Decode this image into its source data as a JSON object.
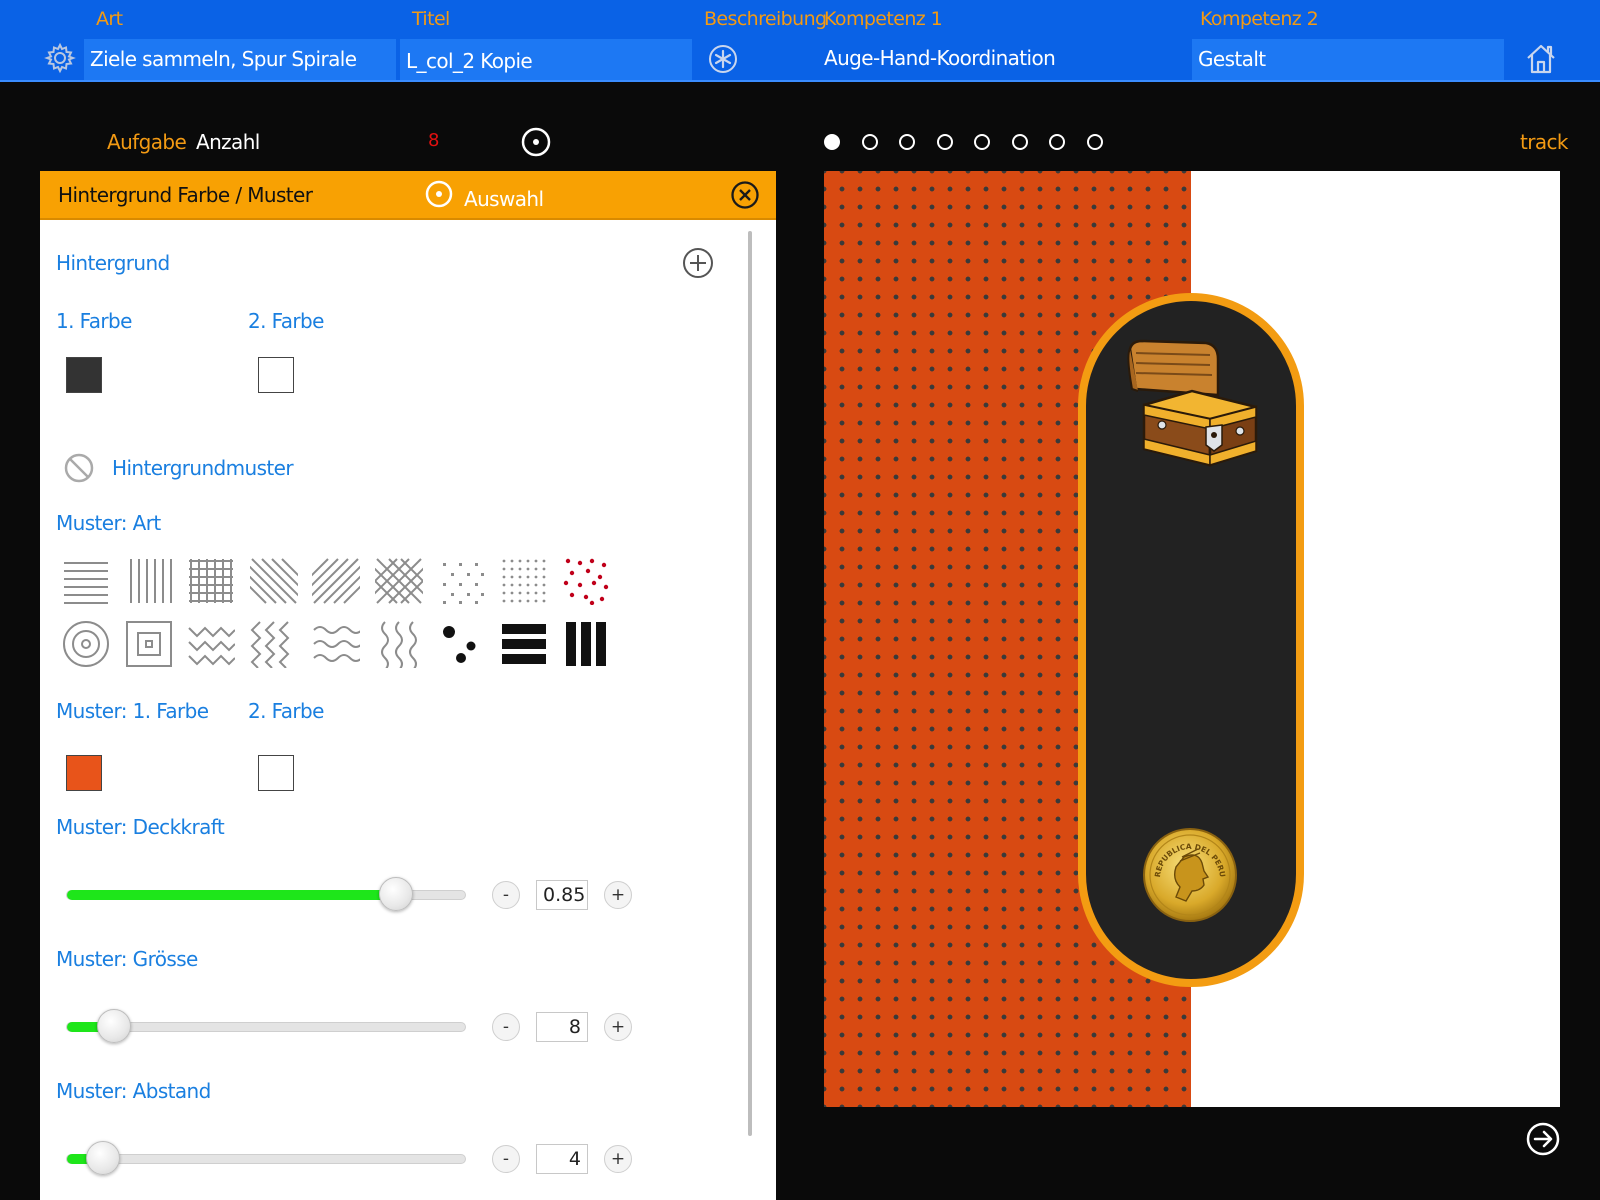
{
  "header": {
    "art_label": "Art",
    "art_value": "Ziele sammeln, Spur Spirale",
    "titel_label": "Titel",
    "titel_value": "L_col_2 Kopie",
    "beschreibung_label": "Beschreibung",
    "kompetenz1_label": "Kompetenz 1",
    "kompetenz1_value": "Auge-Hand-Koordination",
    "kompetenz2_label": "Kompetenz 2",
    "kompetenz2_value": "Gestalt",
    "icons": [
      "gear-icon",
      "asterisk-icon",
      "home-icon"
    ]
  },
  "toolbar": {
    "aufgabe": "Aufgabe",
    "anzahl": "Anzahl",
    "anzahl_value": "8",
    "pager_count": 8,
    "pager_active": 1,
    "track": "track"
  },
  "panel": {
    "title": "Hintergrund Farbe / Muster",
    "auswahl": "Auswahl",
    "hintergrund": "Hintergrund",
    "farbe1": "1. Farbe",
    "farbe2": "2. Farbe",
    "farbe1_color": "#333333",
    "farbe2_color": "#ffffff",
    "hintergrundmuster": "Hintergrundmuster",
    "muster_art": "Muster: Art",
    "patterns": [
      "horizontal-lines",
      "vertical-lines",
      "grid",
      "diagonal-lines-left",
      "diagonal-lines-right",
      "crosshatch",
      "sparse-dots",
      "dense-dots",
      "red-dots",
      "concentric-circles",
      "concentric-squares",
      "zigzag-horizontal",
      "zigzag-vertical",
      "waves-horizontal",
      "waves-vertical",
      "random-dots",
      "thick-horizontal-bars",
      "thick-vertical-bars"
    ],
    "muster_farbe1": "Muster: 1. Farbe",
    "muster_farbe2": "2. Farbe",
    "muster_farbe1_color": "#e8541a",
    "muster_farbe2_color": "#ffffff",
    "deckkraft_label": "Muster: Deckkraft",
    "deckkraft_value": "0.85",
    "deckkraft_fraction": 0.85,
    "groesse_label": "Muster: Grösse",
    "groesse_value": "8",
    "groesse_fraction": 0.09,
    "abstand_label": "Muster: Abstand",
    "abstand_value": "4",
    "abstand_fraction": 0.06,
    "minus": "-",
    "plus": "+"
  },
  "preview": {
    "pattern_color": "#d84a12",
    "track_border_color": "#f39c12",
    "items": [
      "treasure-chest",
      "gold-coin"
    ],
    "coin_text": "REPUBLICA DEL PERU"
  }
}
